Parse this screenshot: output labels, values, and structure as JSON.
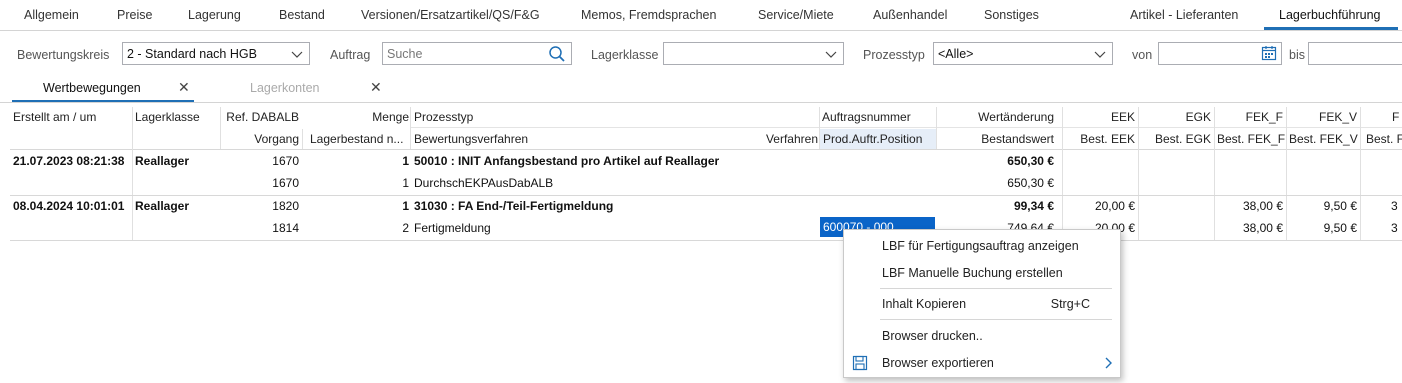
{
  "top_tabs": [
    {
      "label": "Allgemein"
    },
    {
      "label": "Preise"
    },
    {
      "label": "Lagerung"
    },
    {
      "label": "Bestand"
    },
    {
      "label": "Versionen/Ersatzartikel/QS/F&G"
    },
    {
      "label": "Memos, Fremdsprachen"
    },
    {
      "label": "Service/Miete"
    },
    {
      "label": "Außenhandel"
    },
    {
      "label": "Sonstiges"
    },
    {
      "label": "Artikel - Lieferanten"
    },
    {
      "label": "Lagerbuchführung"
    }
  ],
  "filters": {
    "bewertungskreis_label": "Bewertungskreis",
    "bewertungskreis_value": "2 - Standard nach HGB",
    "auftrag_label": "Auftrag",
    "auftrag_placeholder": "Suche",
    "lagerklasse_label": "Lagerklasse",
    "lagerklasse_value": "",
    "prozesstyp_label": "Prozesstyp",
    "prozesstyp_value": "<Alle>",
    "von_label": "von",
    "bis_label": "bis"
  },
  "subtabs": [
    {
      "label": "Wertbewegungen",
      "active": true
    },
    {
      "label": "Lagerkonten",
      "active": false
    }
  ],
  "grid": {
    "headers_top": {
      "erstellt": "Erstellt am / um",
      "lagerklasse": "Lagerklasse",
      "ref": "Ref. DABALB",
      "menge": "Menge",
      "prozesstyp": "Prozesstyp",
      "auftragsnummer": "Auftragsnummer",
      "wertaenderung": "Wertänderung",
      "eek": "EEK",
      "egk": "EGK",
      "fek_f": "FEK_F",
      "fek_v": "FEK_V",
      "extra": "F"
    },
    "headers_bottom": {
      "vorgang": "Vorgang",
      "lagerbestand": "Lagerbestand n...",
      "bewertungsverfahren": "Bewertungsverfahren",
      "verfahren": "Verfahren",
      "prod_position": "Prod.Auftr.Position",
      "bestandswert": "Bestandswert",
      "best_eek": "Best. EEK",
      "best_egk": "Best. EGK",
      "best_fek_f": "Best. FEK_F",
      "best_fek_v": "Best. FEK_V",
      "best_extra": "Best. F"
    },
    "groups": [
      {
        "datetime": "21.07.2023 08:21:38",
        "lagerklasse": "Reallager",
        "ref": "1670",
        "menge": "1",
        "prozesstyp": "50010 : INIT Anfangsbestand pro Artikel auf Reallager",
        "auftragsnummer": "",
        "wertaenderung": "650,30 €",
        "eek": "",
        "egk": "",
        "fek_f": "",
        "fek_v": "",
        "extra": "",
        "vorgang": "1670",
        "lagerbestand": "1",
        "bewertungsverfahren": "DurchschEKPAusDabALB",
        "prod_position": "",
        "bestandswert": "650,30 €",
        "best_eek": "",
        "best_egk": "",
        "best_fek_f": "",
        "best_fek_v": "",
        "best_extra": ""
      },
      {
        "datetime": "08.04.2024 10:01:01",
        "lagerklasse": "Reallager",
        "ref": "1820",
        "menge": "1",
        "prozesstyp": "31030 : FA End-/Teil-Fertigmeldung",
        "auftragsnummer": "",
        "wertaenderung": "99,34 €",
        "eek": "20,00 €",
        "egk": "",
        "fek_f": "38,00 €",
        "fek_v": "9,50 €",
        "extra": "3",
        "vorgang": "1814",
        "lagerbestand": "2",
        "bewertungsverfahren": "Fertigmeldung",
        "prod_position": "600070 - 000",
        "bestandswert": "749,64 €",
        "best_eek": "20,00 €",
        "best_egk": "",
        "best_fek_f": "38,00 €",
        "best_fek_v": "9,50 €",
        "best_extra": "3"
      }
    ]
  },
  "context_menu": {
    "item1": "LBF für Fertigungsauftrag anzeigen",
    "item2": "LBF Manuelle Buchung erstellen",
    "item3": "Inhalt Kopieren",
    "item3_shortcut": "Strg+C",
    "item4": "Browser drucken..",
    "item5": "Browser exportieren",
    "item5_icon": "save-icon",
    "item5_submenu_icon": "chevron-right-icon"
  },
  "colors": {
    "accent": "#1f6fb5",
    "selection": "#0a64c8"
  }
}
